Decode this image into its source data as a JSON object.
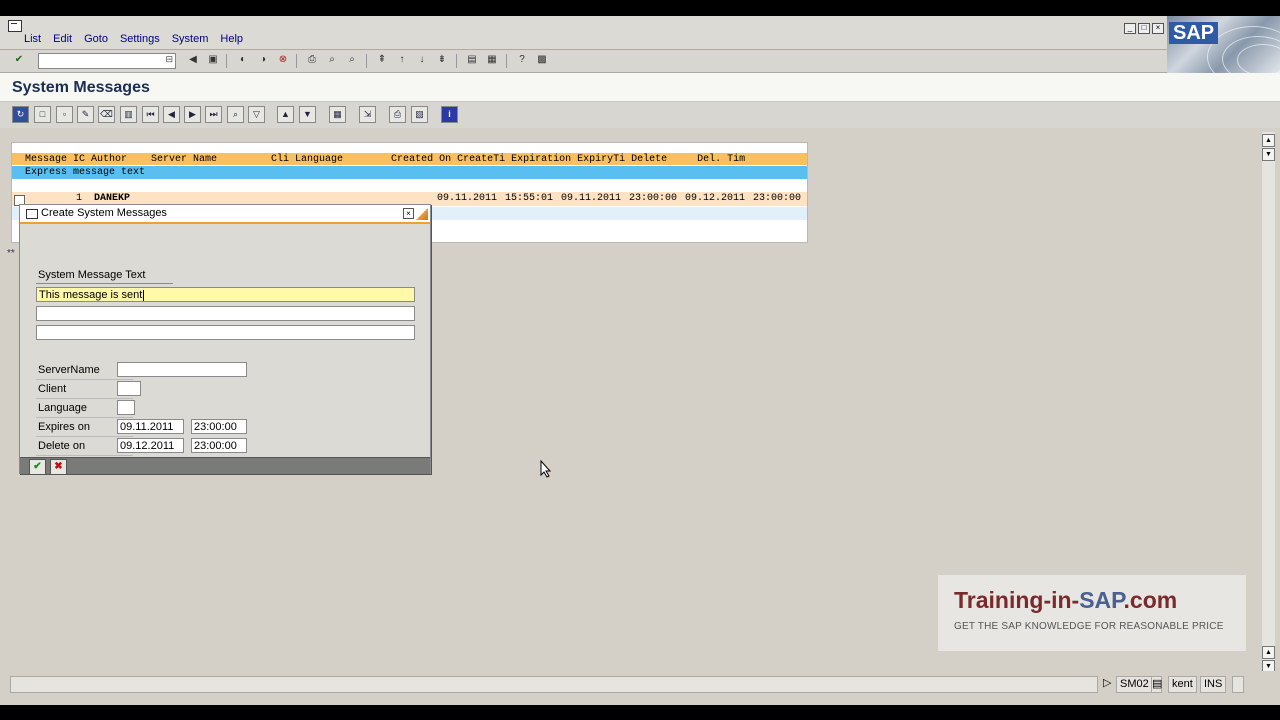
{
  "menu": {
    "items": [
      "List",
      "Edit",
      "Goto",
      "Settings",
      "System",
      "Help"
    ]
  },
  "logo": {
    "text": "SAP"
  },
  "screen": {
    "title": "System Messages"
  },
  "list": {
    "header": "Message IC Author    Server Name         Cli Language        Created On CreateTi Expiration ExpiryTi Delete     Del. Tim",
    "subheader": "Express message text",
    "rows": [
      {
        "id": "1",
        "author": "DANEKP",
        "created_on": "09.11.2011",
        "create_time": "15:55:01",
        "expiration": "09.11.2011",
        "expiry_time": "23:00:00",
        "delete": "09.12.2011",
        "del_time": "23:00:00"
      }
    ],
    "stars": "**"
  },
  "dialog": {
    "title": "Create System Messages",
    "text_label": "System Message Text",
    "text_line1": "This message is sent",
    "text_line2": "",
    "text_line3": "",
    "server_label": "ServerName",
    "server_value": "",
    "client_label": "Client",
    "client_value": "",
    "language_label": "Language",
    "language_value": "",
    "expires_label": "Expires on",
    "expires_date": "09.11.2011",
    "expires_time": "23:00:00",
    "delete_label": "Delete on",
    "delete_date": "09.12.2011",
    "delete_time": "23:00:00"
  },
  "watermark": {
    "brand_part1": "Training-in-",
    "brand_part2": "SAP",
    "brand_part3": ".com",
    "tagline": "GET THE SAP KNOWLEDGE FOR REASONABLE PRICE"
  },
  "status": {
    "transaction": "SM02",
    "user": "kent",
    "mode": "INS"
  },
  "colors": {
    "header_orange": "#f9c060",
    "subheader_blue": "#59bff0",
    "active_field": "#fff9a8",
    "accent_line": "#f0a030"
  }
}
